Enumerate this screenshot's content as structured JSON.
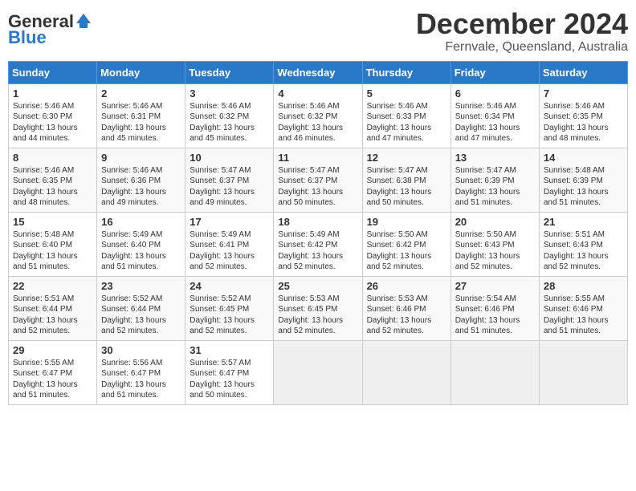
{
  "logo": {
    "line1": "General",
    "line2": "Blue"
  },
  "title": "December 2024",
  "location": "Fernvale, Queensland, Australia",
  "weekdays": [
    "Sunday",
    "Monday",
    "Tuesday",
    "Wednesday",
    "Thursday",
    "Friday",
    "Saturday"
  ],
  "weeks": [
    [
      {
        "day": "1",
        "sunrise": "5:46 AM",
        "sunset": "6:30 PM",
        "daylight": "13 hours and 44 minutes."
      },
      {
        "day": "2",
        "sunrise": "5:46 AM",
        "sunset": "6:31 PM",
        "daylight": "13 hours and 45 minutes."
      },
      {
        "day": "3",
        "sunrise": "5:46 AM",
        "sunset": "6:32 PM",
        "daylight": "13 hours and 45 minutes."
      },
      {
        "day": "4",
        "sunrise": "5:46 AM",
        "sunset": "6:32 PM",
        "daylight": "13 hours and 46 minutes."
      },
      {
        "day": "5",
        "sunrise": "5:46 AM",
        "sunset": "6:33 PM",
        "daylight": "13 hours and 47 minutes."
      },
      {
        "day": "6",
        "sunrise": "5:46 AM",
        "sunset": "6:34 PM",
        "daylight": "13 hours and 47 minutes."
      },
      {
        "day": "7",
        "sunrise": "5:46 AM",
        "sunset": "6:35 PM",
        "daylight": "13 hours and 48 minutes."
      }
    ],
    [
      {
        "day": "8",
        "sunrise": "5:46 AM",
        "sunset": "6:35 PM",
        "daylight": "13 hours and 48 minutes."
      },
      {
        "day": "9",
        "sunrise": "5:46 AM",
        "sunset": "6:36 PM",
        "daylight": "13 hours and 49 minutes."
      },
      {
        "day": "10",
        "sunrise": "5:47 AM",
        "sunset": "6:37 PM",
        "daylight": "13 hours and 49 minutes."
      },
      {
        "day": "11",
        "sunrise": "5:47 AM",
        "sunset": "6:37 PM",
        "daylight": "13 hours and 50 minutes."
      },
      {
        "day": "12",
        "sunrise": "5:47 AM",
        "sunset": "6:38 PM",
        "daylight": "13 hours and 50 minutes."
      },
      {
        "day": "13",
        "sunrise": "5:47 AM",
        "sunset": "6:39 PM",
        "daylight": "13 hours and 51 minutes."
      },
      {
        "day": "14",
        "sunrise": "5:48 AM",
        "sunset": "6:39 PM",
        "daylight": "13 hours and 51 minutes."
      }
    ],
    [
      {
        "day": "15",
        "sunrise": "5:48 AM",
        "sunset": "6:40 PM",
        "daylight": "13 hours and 51 minutes."
      },
      {
        "day": "16",
        "sunrise": "5:49 AM",
        "sunset": "6:40 PM",
        "daylight": "13 hours and 51 minutes."
      },
      {
        "day": "17",
        "sunrise": "5:49 AM",
        "sunset": "6:41 PM",
        "daylight": "13 hours and 52 minutes."
      },
      {
        "day": "18",
        "sunrise": "5:49 AM",
        "sunset": "6:42 PM",
        "daylight": "13 hours and 52 minutes."
      },
      {
        "day": "19",
        "sunrise": "5:50 AM",
        "sunset": "6:42 PM",
        "daylight": "13 hours and 52 minutes."
      },
      {
        "day": "20",
        "sunrise": "5:50 AM",
        "sunset": "6:43 PM",
        "daylight": "13 hours and 52 minutes."
      },
      {
        "day": "21",
        "sunrise": "5:51 AM",
        "sunset": "6:43 PM",
        "daylight": "13 hours and 52 minutes."
      }
    ],
    [
      {
        "day": "22",
        "sunrise": "5:51 AM",
        "sunset": "6:44 PM",
        "daylight": "13 hours and 52 minutes."
      },
      {
        "day": "23",
        "sunrise": "5:52 AM",
        "sunset": "6:44 PM",
        "daylight": "13 hours and 52 minutes."
      },
      {
        "day": "24",
        "sunrise": "5:52 AM",
        "sunset": "6:45 PM",
        "daylight": "13 hours and 52 minutes."
      },
      {
        "day": "25",
        "sunrise": "5:53 AM",
        "sunset": "6:45 PM",
        "daylight": "13 hours and 52 minutes."
      },
      {
        "day": "26",
        "sunrise": "5:53 AM",
        "sunset": "6:46 PM",
        "daylight": "13 hours and 52 minutes."
      },
      {
        "day": "27",
        "sunrise": "5:54 AM",
        "sunset": "6:46 PM",
        "daylight": "13 hours and 51 minutes."
      },
      {
        "day": "28",
        "sunrise": "5:55 AM",
        "sunset": "6:46 PM",
        "daylight": "13 hours and 51 minutes."
      }
    ],
    [
      {
        "day": "29",
        "sunrise": "5:55 AM",
        "sunset": "6:47 PM",
        "daylight": "13 hours and 51 minutes."
      },
      {
        "day": "30",
        "sunrise": "5:56 AM",
        "sunset": "6:47 PM",
        "daylight": "13 hours and 51 minutes."
      },
      {
        "day": "31",
        "sunrise": "5:57 AM",
        "sunset": "6:47 PM",
        "daylight": "13 hours and 50 minutes."
      },
      null,
      null,
      null,
      null
    ]
  ]
}
